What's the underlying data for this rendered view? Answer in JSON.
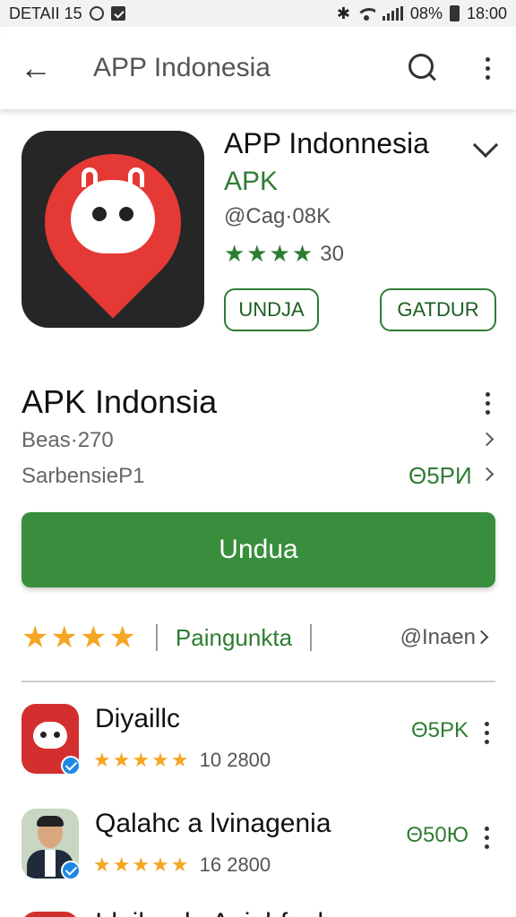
{
  "status_bar": {
    "left_text": "DETAII 15",
    "right_text": "08%",
    "time": "18:00",
    "bluetooth_glyph": "✱"
  },
  "app_bar": {
    "back_icon": "←",
    "title": "APP Indonesia"
  },
  "app": {
    "title": "APP Indonnesia",
    "subtitle": "APK",
    "meta": "@Cag·08K",
    "stars": "★★★★",
    "rating_count": "30",
    "button_left": "UNDJA",
    "button_right": "GATDUR"
  },
  "section": {
    "title": "APK Indonsia",
    "row1": "Beas·270",
    "row2_label": "SarbensieP1",
    "row2_value": "Θ5PИ"
  },
  "primary_button": "Undua",
  "rating_bar": {
    "stars": "★★★★",
    "tag": "Paingunkta",
    "right": "@Inaen"
  },
  "list": [
    {
      "name": "Diyaillc",
      "stars": "★★★★★",
      "count": "10 2800",
      "value": "Θ5PK"
    },
    {
      "name": "Qalahc a lvinagenia",
      "stars": "★★★★★",
      "count": "16 2800",
      "value": "Θ50Ю"
    }
  ],
  "partial_item": "Irlaih ode Aaiahfaaln",
  "colors": {
    "accent_green": "#2e7d32",
    "button_green": "#388e3c",
    "brand_red": "#e53935",
    "star_gold": "#f5a623"
  }
}
